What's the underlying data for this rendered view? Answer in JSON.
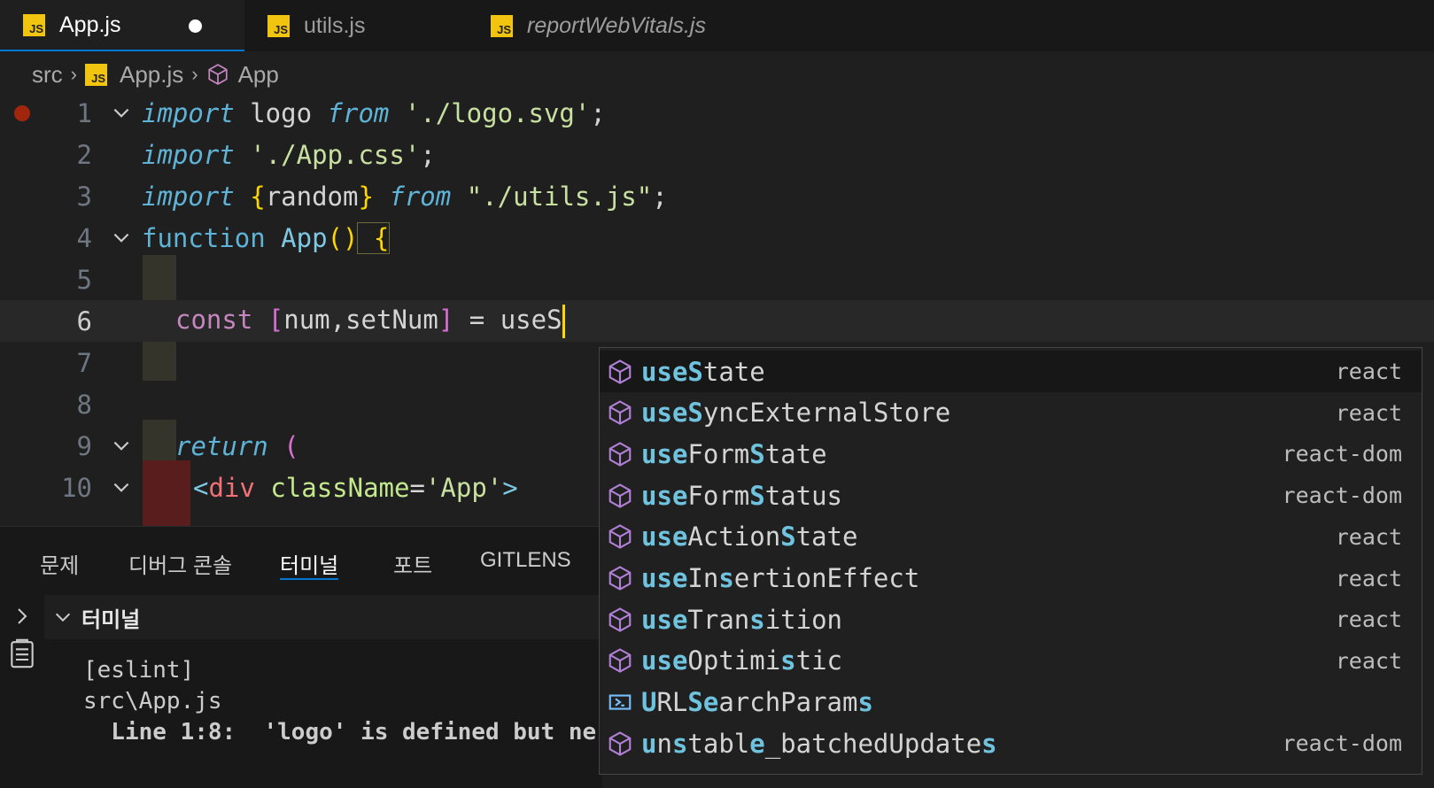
{
  "tabs": [
    {
      "label": "App.js",
      "active": true,
      "dirty": true,
      "icon": "js-file-icon"
    },
    {
      "label": "utils.js",
      "active": false,
      "icon": "js-file-icon"
    },
    {
      "label": "reportWebVitals.js",
      "active": false,
      "italic": true,
      "icon": "js-file-icon"
    }
  ],
  "breadcrumb": {
    "folder": "src",
    "file": "App.js",
    "symbol": "App",
    "js_badge": "JS"
  },
  "editor": {
    "lines": [
      {
        "num": "1"
      },
      {
        "num": "2"
      },
      {
        "num": "3"
      },
      {
        "num": "4"
      },
      {
        "num": "5"
      },
      {
        "num": "6"
      },
      {
        "num": "7"
      },
      {
        "num": "8"
      },
      {
        "num": "9"
      },
      {
        "num": "10"
      }
    ],
    "code": {
      "l1": {
        "kw1": "import",
        "id": " logo ",
        "kw2": "from",
        "str": " './logo.svg'",
        "end": ";"
      },
      "l2": {
        "kw1": "import",
        "str": " './App.css'",
        "end": ";"
      },
      "l3": {
        "kw1": "import",
        "ob": " {",
        "id": "random",
        "cb": "}",
        "kw2": " from",
        "str": " \"./utils.js\"",
        "end": ";"
      },
      "l4": {
        "kw": "function",
        "fn": " App",
        "paren": "()",
        "brace": " {"
      },
      "l6": {
        "kw": "const",
        "ob": " [",
        "id": "num,setNum",
        "cb": "]",
        "rest": " = useS"
      },
      "l9": {
        "kw": "return",
        "paren": " ("
      },
      "l10": {
        "lt": "<",
        "tag": "div",
        "attr": " className",
        "eq": "=",
        "str": "'App'",
        "gt": ">"
      }
    }
  },
  "panel": {
    "tabs": [
      "문제",
      "디버그 콘솔",
      "터미널",
      "포트",
      "GITLENS"
    ],
    "active_tab": "터미널",
    "terminal_title": "터미널",
    "output": [
      "[eslint]",
      "src\\App.js",
      "  Line 1:8:  'logo' is defined but ne"
    ]
  },
  "suggestions": [
    {
      "label": "useState",
      "match": "useS",
      "detail": "react",
      "selected": true,
      "icon": "cube-icon"
    },
    {
      "label": "useSyncExternalStore",
      "detail": "react",
      "icon": "cube-icon"
    },
    {
      "label": "useFormState",
      "detail": "react-dom",
      "icon": "cube-icon"
    },
    {
      "label": "useFormStatus",
      "detail": "react-dom",
      "icon": "cube-icon"
    },
    {
      "label": "useActionState",
      "detail": "react",
      "icon": "cube-icon"
    },
    {
      "label": "useInsertionEffect",
      "detail": "react",
      "icon": "cube-icon"
    },
    {
      "label": "useTransition",
      "detail": "react",
      "icon": "cube-icon"
    },
    {
      "label": "useOptimistic",
      "detail": "react",
      "icon": "cube-icon"
    },
    {
      "label": "URLSearchParams",
      "detail": "",
      "icon": "class-icon"
    },
    {
      "label": "unstable_batchedUpdates",
      "detail": "react-dom",
      "icon": "cube-icon"
    }
  ],
  "colors": {
    "accent": "#0078d4",
    "js_badge": "#f1c40f",
    "match_highlight": "#6fc3df"
  }
}
